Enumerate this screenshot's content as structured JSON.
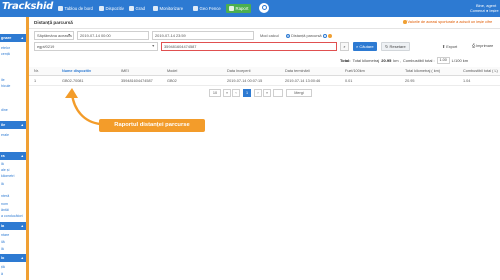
{
  "app": {
    "logo": "Trackshid",
    "nav": [
      {
        "label": "Tablou de bord"
      },
      {
        "label": "Dispozitiv"
      },
      {
        "label": "Grad"
      },
      {
        "label": "Monitorizare"
      },
      {
        "label": "Geo Fence"
      },
      {
        "label": "Raport"
      }
    ],
    "user": {
      "name": "Bine, agent",
      "links": "Comenzi  ● Ieșire"
    },
    "accent": "#2d7ad2",
    "highlight": "#f39c2a"
  },
  "sidebar": {
    "heads": [
      {
        "label": "gnare"
      },
      {
        "label": "ile"
      },
      {
        "label": "ra"
      },
      {
        "label": "la"
      },
      {
        "label": "lo"
      }
    ],
    "items": [
      "etelor",
      "cență",
      "ile",
      "hicule",
      "dine",
      "erale",
      "lă",
      "ale și",
      "kilometri",
      "lă",
      "nteră",
      "nom",
      "ăntăi",
      "a conducători",
      "ntare",
      "ilă",
      "lă",
      "țiă",
      "ă"
    ]
  },
  "page": {
    "title": "Distanță parcursă",
    "notice": "Valorile de aceasi sporturale a aciscit un ieșie cifre"
  },
  "filters": {
    "period": "Săptămâna aceasta",
    "date_from": "2019-07-14 00:00",
    "date_to": "2019-07-14 23:59",
    "mode_label": "Mod calcul",
    "mode_option": "Distanță parcursă",
    "device_group": "egpt/0219",
    "device_id": "359481604474587",
    "search_button": "Căutare",
    "reset_button": "Resetare",
    "export_label": "Export",
    "print_label": "Imprimare"
  },
  "totals": {
    "label": "Total:",
    "distance_label": "Total kilometraj",
    "distance_value": "20.95",
    "distance_unit": "km ,",
    "fuel_label": "Combustibil total :",
    "fuel_rate": "1.00",
    "fuel_unit": "L/100 km"
  },
  "table": {
    "headers": [
      "Nr.",
      "Nume dispozitiv",
      "IMEI",
      "Model",
      "Data începerii",
      "Data terminării",
      "Fuel/100km",
      "Total kilometraj ( km)",
      "Combustibil total ( L)"
    ],
    "rows": [
      [
        "1",
        "GB02-70081",
        "359481604474587",
        "GB02",
        "2019-07-14 00:07:15",
        "2019-07-14 13:00:46",
        "0.01",
        "20.95",
        "1.04"
      ]
    ]
  },
  "pagination": {
    "size": "10",
    "current": "1",
    "goto_label": "Mergi"
  },
  "annotation": {
    "text": "Raportul distanței parcurse"
  }
}
